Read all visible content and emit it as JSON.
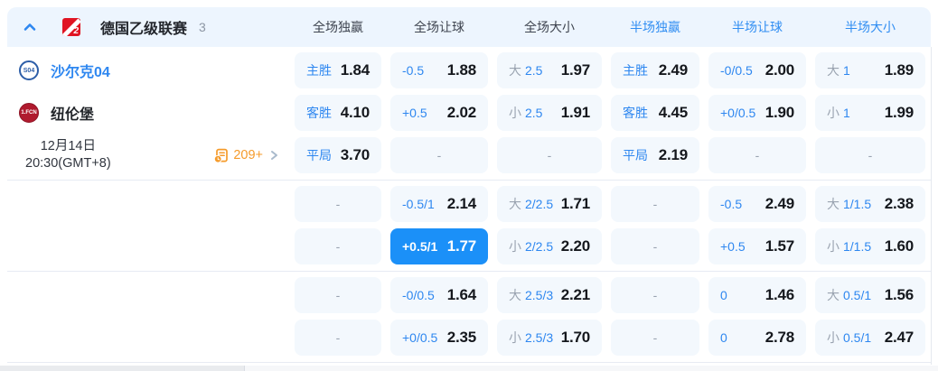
{
  "header": {
    "league": "德国乙级联赛",
    "count": "3",
    "columns": [
      {
        "label": "全场独赢",
        "scope": "full"
      },
      {
        "label": "全场让球",
        "scope": "full"
      },
      {
        "label": "全场大小",
        "scope": "full"
      },
      {
        "label": "半场独赢",
        "scope": "half"
      },
      {
        "label": "半场让球",
        "scope": "half"
      },
      {
        "label": "半场大小",
        "scope": "half"
      }
    ]
  },
  "match": {
    "home": {
      "name": "沙尔克04",
      "badge": "S04"
    },
    "away": {
      "name": "纽伦堡",
      "badge": "1.FCN"
    },
    "date": "12月14日",
    "time": "20:30(GMT+8)",
    "more_markets": "209+"
  },
  "symbols": {
    "dash": "-"
  },
  "colors": {
    "accent_selected": "#1b90f8",
    "label_blue": "#2e87f0",
    "half_header_blue": "#2f8df2",
    "ou_gray": "#9aa3b0",
    "odds_text": "#15181d",
    "markets_orange": "#f59b2b",
    "cell_bg": "#f3f8fd",
    "header_band_bg": "#edf5fe"
  },
  "odds_groups": [
    {
      "rows": [
        {
          "info": "home",
          "cells": [
            {
              "t": "lv",
              "l": "主胜",
              "v": "1.84"
            },
            {
              "t": "lv",
              "l": "-0.5",
              "v": "1.88"
            },
            {
              "t": "ou",
              "p": "大",
              "h": "2.5",
              "v": "1.97"
            },
            {
              "t": "lv",
              "l": "主胜",
              "v": "2.49"
            },
            {
              "t": "lv",
              "l": "-0/0.5",
              "v": "2.00"
            },
            {
              "t": "ou",
              "p": "大",
              "h": "1",
              "v": "1.89"
            }
          ]
        },
        {
          "info": "away",
          "cells": [
            {
              "t": "lv",
              "l": "客胜",
              "v": "4.10"
            },
            {
              "t": "lv",
              "l": "+0.5",
              "v": "2.02"
            },
            {
              "t": "ou",
              "p": "小",
              "h": "2.5",
              "v": "1.91"
            },
            {
              "t": "lv",
              "l": "客胜",
              "v": "4.45"
            },
            {
              "t": "lv",
              "l": "+0/0.5",
              "v": "1.90"
            },
            {
              "t": "ou",
              "p": "小",
              "h": "1",
              "v": "1.99"
            }
          ]
        },
        {
          "info": "meta",
          "cells": [
            {
              "t": "lv",
              "l": "平局",
              "v": "3.70"
            },
            {
              "t": "dash"
            },
            {
              "t": "dash"
            },
            {
              "t": "lv",
              "l": "平局",
              "v": "2.19"
            },
            {
              "t": "dash"
            },
            {
              "t": "dash"
            }
          ]
        }
      ]
    },
    {
      "rows": [
        {
          "info": "empty",
          "cells": [
            {
              "t": "dash"
            },
            {
              "t": "lv",
              "l": "-0.5/1",
              "v": "2.14"
            },
            {
              "t": "ou",
              "p": "大",
              "h": "2/2.5",
              "v": "1.71"
            },
            {
              "t": "dash"
            },
            {
              "t": "lv",
              "l": "-0.5",
              "v": "2.49"
            },
            {
              "t": "ou",
              "p": "大",
              "h": "1/1.5",
              "v": "2.38"
            }
          ]
        },
        {
          "info": "empty",
          "cells": [
            {
              "t": "dash"
            },
            {
              "t": "lv",
              "l": "+0.5/1",
              "v": "1.77",
              "sel": true
            },
            {
              "t": "ou",
              "p": "小",
              "h": "2/2.5",
              "v": "2.20"
            },
            {
              "t": "dash"
            },
            {
              "t": "lv",
              "l": "+0.5",
              "v": "1.57"
            },
            {
              "t": "ou",
              "p": "小",
              "h": "1/1.5",
              "v": "1.60"
            }
          ]
        }
      ]
    },
    {
      "rows": [
        {
          "info": "empty",
          "cells": [
            {
              "t": "dash"
            },
            {
              "t": "lv",
              "l": "-0/0.5",
              "v": "1.64"
            },
            {
              "t": "ou",
              "p": "大",
              "h": "2.5/3",
              "v": "2.21"
            },
            {
              "t": "dash"
            },
            {
              "t": "lv",
              "l": "0",
              "v": "1.46"
            },
            {
              "t": "ou",
              "p": "大",
              "h": "0.5/1",
              "v": "1.56"
            }
          ]
        },
        {
          "info": "empty",
          "cells": [
            {
              "t": "dash"
            },
            {
              "t": "lv",
              "l": "+0/0.5",
              "v": "2.35"
            },
            {
              "t": "ou",
              "p": "小",
              "h": "2.5/3",
              "v": "1.70"
            },
            {
              "t": "dash"
            },
            {
              "t": "lv",
              "l": "0",
              "v": "2.78"
            },
            {
              "t": "ou",
              "p": "小",
              "h": "0.5/1",
              "v": "2.47"
            }
          ]
        }
      ]
    }
  ]
}
